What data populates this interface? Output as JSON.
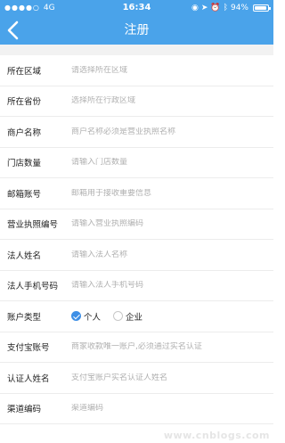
{
  "status_bar": {
    "carrier": "4G",
    "time": "16:34",
    "battery": "94%",
    "battery_level": 0.94
  },
  "nav": {
    "title": "注册"
  },
  "form": {
    "rows": [
      {
        "label": "所在区域",
        "placeholder": "请选择所在区域"
      },
      {
        "label": "所在省份",
        "placeholder": "选择所在行政区域"
      },
      {
        "label": "商户名称",
        "placeholder": "商户名称必须是营业执照名称"
      },
      {
        "label": "门店数量",
        "placeholder": "请输入门店数量"
      },
      {
        "label": "邮箱账号",
        "placeholder": "邮箱用于接收重要信息"
      },
      {
        "label": "营业执照编号",
        "placeholder": "请输入营业执照编码"
      },
      {
        "label": "法人姓名",
        "placeholder": "请输入法人名称"
      },
      {
        "label": "法人手机号码",
        "placeholder": "请输入法人手机号码"
      }
    ],
    "account_type": {
      "label": "账户类型",
      "options": [
        {
          "label": "个人",
          "checked": true
        },
        {
          "label": "企业",
          "checked": false
        }
      ]
    },
    "rows_after": [
      {
        "label": "支付宝账号",
        "placeholder": "商家收款唯一账户,必须通过实名认证"
      },
      {
        "label": "认证人姓名",
        "placeholder": "支付宝账户实名认证人姓名"
      },
      {
        "label": "渠道编码",
        "placeholder": "渠道编码"
      }
    ]
  },
  "watermark": "www.cnblogs.com"
}
